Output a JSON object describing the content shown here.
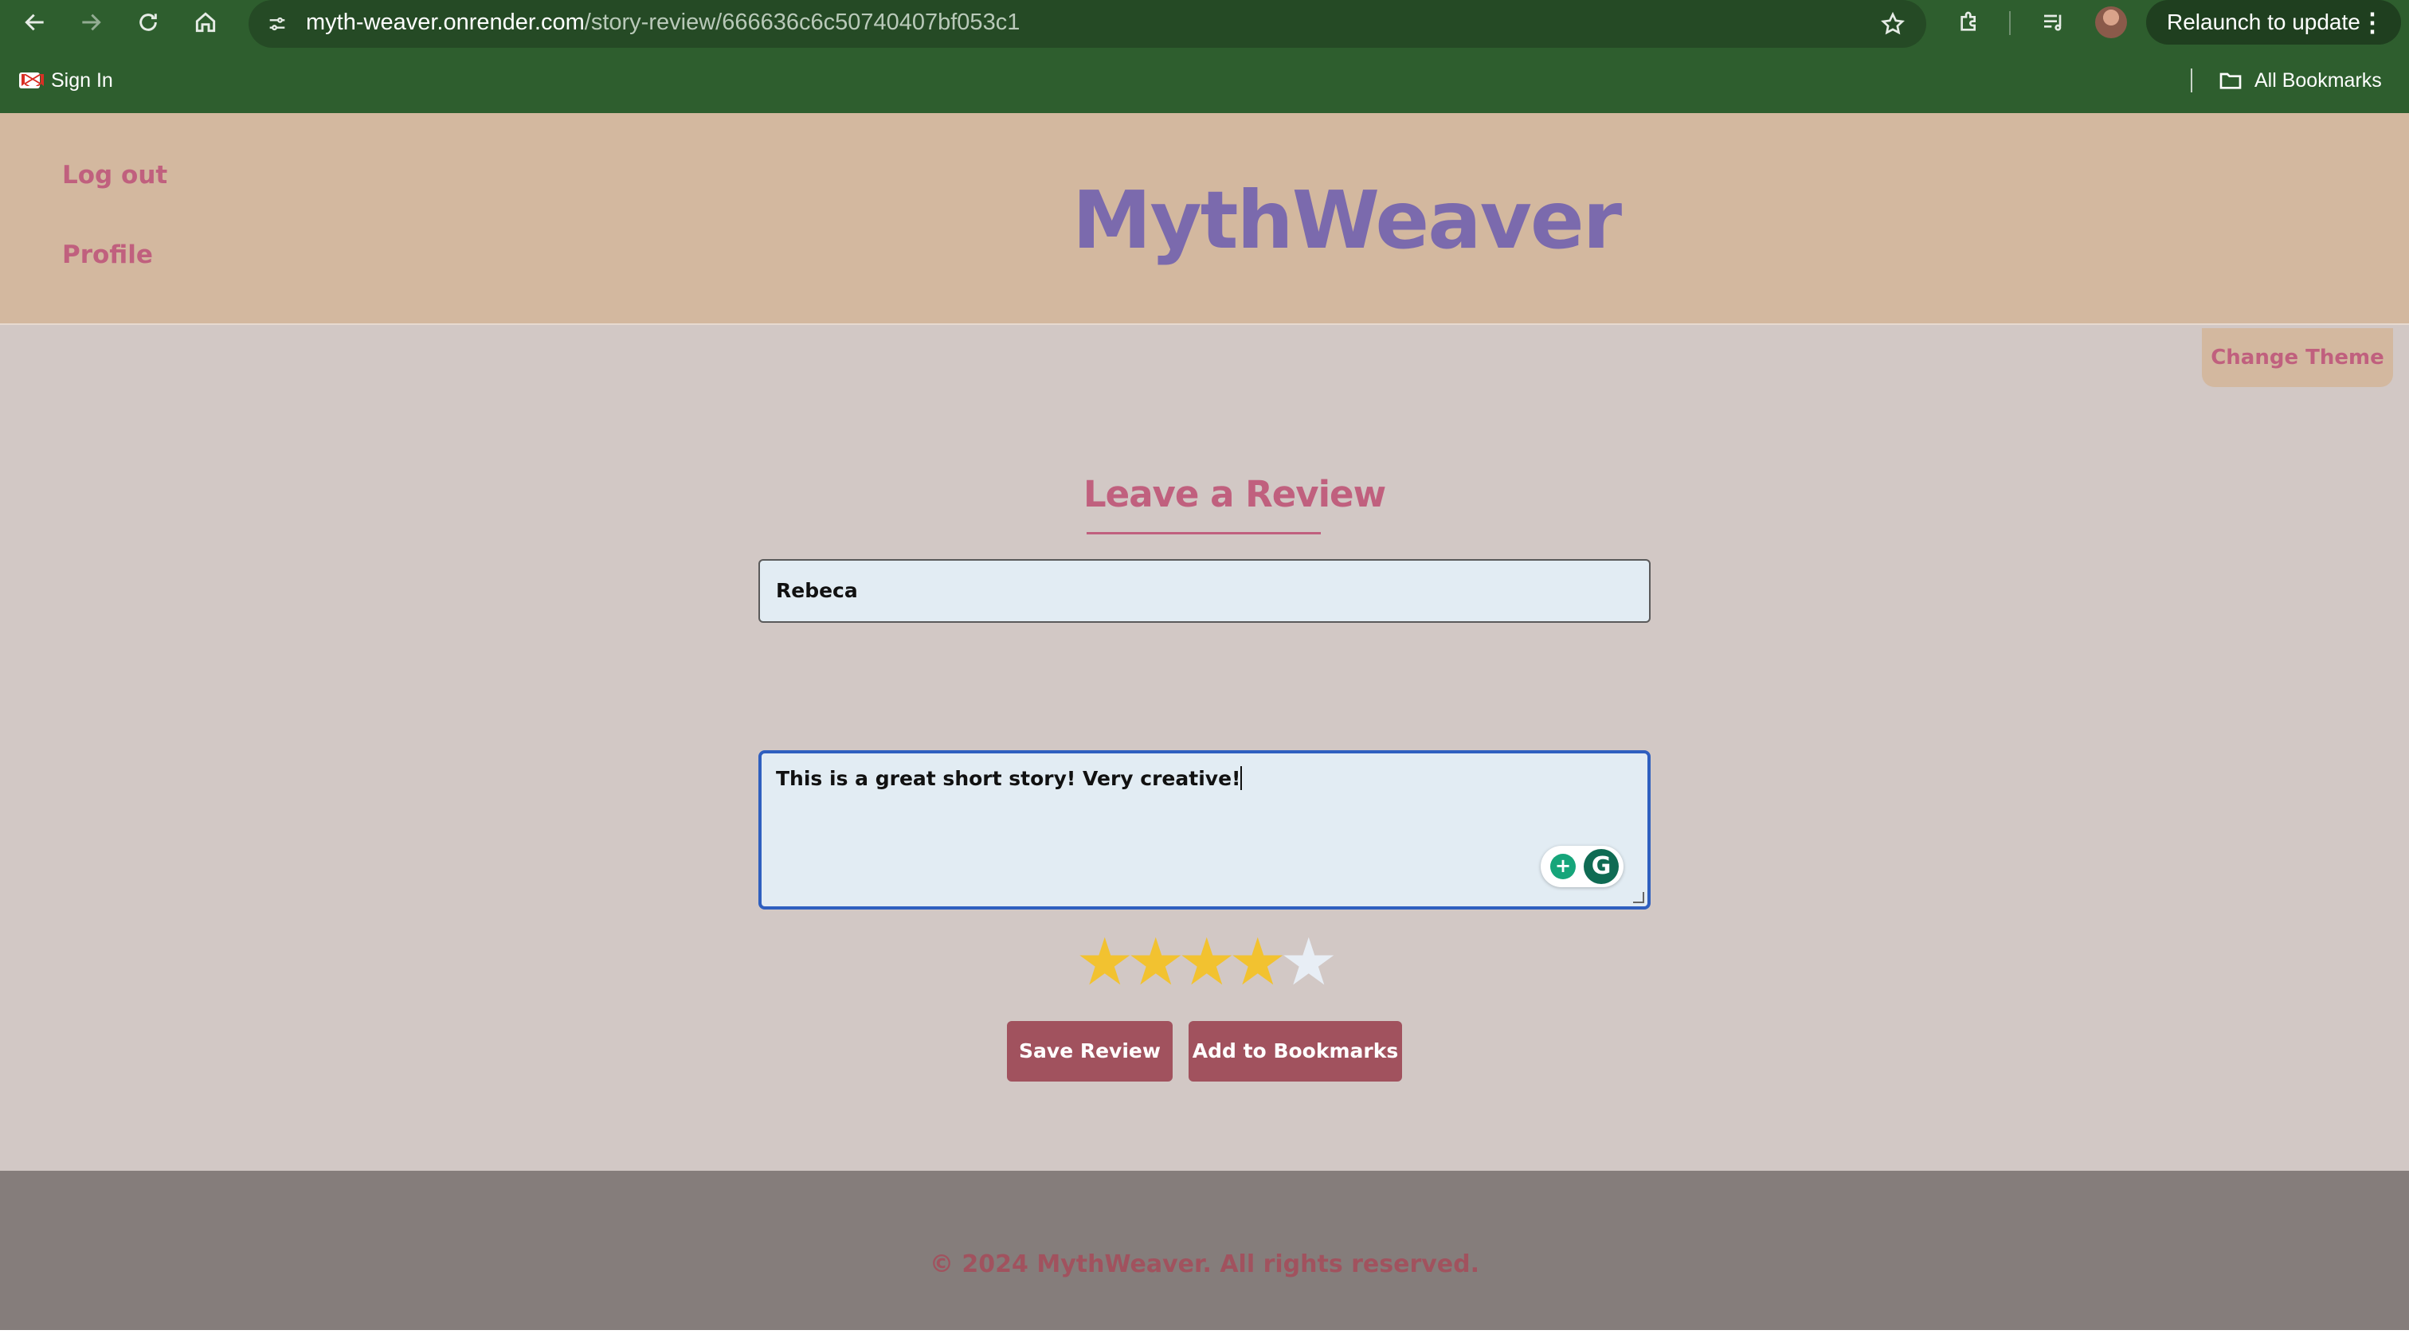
{
  "browser": {
    "url_host": "myth-weaver.onrender.com",
    "url_path": "/story-review/666636c6c50740407bf053c1",
    "relaunch_label": "Relaunch to update",
    "bookmarks": {
      "left_item": "Sign In",
      "right_item": "All Bookmarks"
    }
  },
  "header": {
    "logout": "Log out",
    "profile": "Profile",
    "logo": "MythWeaver",
    "change_theme": "Change Theme"
  },
  "review": {
    "title": "Leave a Review",
    "name_value": "Rebeca",
    "text_value": "This is a great short story! Very creative!",
    "rating": 4,
    "rating_max": 5,
    "save_label": "Save Review",
    "bookmark_label": "Add to Bookmarks"
  },
  "footer": {
    "text": "© 2024 MythWeaver. All rights reserved."
  },
  "colors": {
    "browser_chrome": "#2e5e2e",
    "header_bg": "#d3b89f",
    "page_bg": "#d2c8c5",
    "accent_pink": "#c0607e",
    "logo_purple": "#7b6aad",
    "button_bg": "#a1525e",
    "footer_bg": "#857d7b",
    "star_on": "#f2c230"
  }
}
